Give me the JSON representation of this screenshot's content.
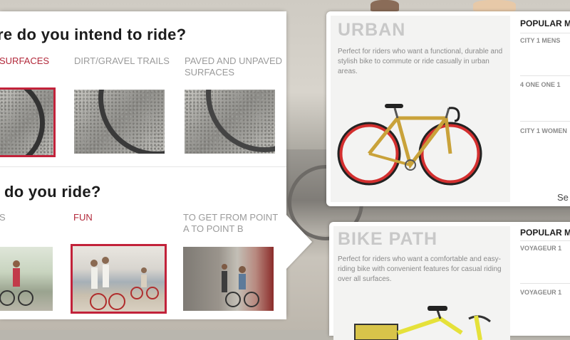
{
  "left_panel": {
    "question_surface": "re do you intend to ride?",
    "surface_options": [
      {
        "label": "SURFACES",
        "selected": true
      },
      {
        "label": "DIRT/GRAVEL TRAILS",
        "selected": false
      },
      {
        "label": "PAVED AND UNPAVED SURFACES",
        "selected": false
      }
    ],
    "question_purpose": "do you ride?",
    "purpose_options": [
      {
        "label": "S",
        "selected": false
      },
      {
        "label": "FUN",
        "selected": true
      },
      {
        "label": "TO GET FROM POINT A TO POINT B",
        "selected": false
      }
    ]
  },
  "cards": [
    {
      "title": "URBAN",
      "description": "Perfect for riders who want a functional, durable and stylish bike to commute or ride casually in urban areas.",
      "popular_label": "POPULAR M",
      "products": [
        "CITY 1 MENS",
        "4 ONE ONE 1",
        "CITY 1 WOMEN"
      ],
      "see_label": "Se",
      "bike_color": "#c9a23a",
      "rim_color": "#c62828"
    },
    {
      "title": "BIKE PATH",
      "description": "Perfect for riders who want a comfortable and easy-riding bike with convenient features for casual riding over all surfaces.",
      "popular_label": "POPULAR M",
      "products": [
        "VOYAGEUR 1",
        "VOYAGEUR 1"
      ],
      "bike_color": "#e5e13a"
    }
  ],
  "colors": {
    "accent": "#c2223a",
    "muted_text": "#9b9b9b"
  }
}
